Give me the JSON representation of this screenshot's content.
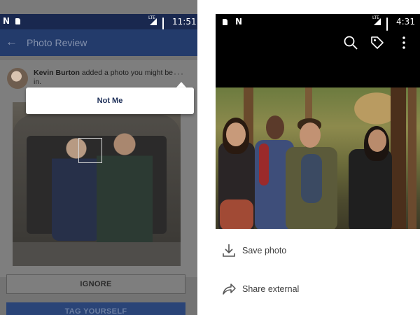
{
  "left": {
    "status": {
      "time": "11:51",
      "network": "LTE"
    },
    "appbar": {
      "title": "Photo Review",
      "back_icon": "arrow-left-icon"
    },
    "post": {
      "author": "Kevin Burton",
      "text": " added a photo you might be in.",
      "more_icon": "more-dots-icon"
    },
    "popup": {
      "label": "Not Me"
    },
    "buttons": {
      "ignore": "IGNORE",
      "tag": "TAG YOURSELF"
    },
    "colors": {
      "appbar": "#233b6b",
      "statusbar": "#19284f",
      "overlay": "#737373"
    }
  },
  "right": {
    "status": {
      "time": "4:31",
      "network": "LTE"
    },
    "toolbar_icons": [
      "search-icon",
      "tag-icon",
      "more-vertical-icon"
    ],
    "actions": [
      {
        "label": "Save photo",
        "icon": "download-icon"
      },
      {
        "label": "Share external",
        "icon": "share-icon"
      }
    ]
  }
}
